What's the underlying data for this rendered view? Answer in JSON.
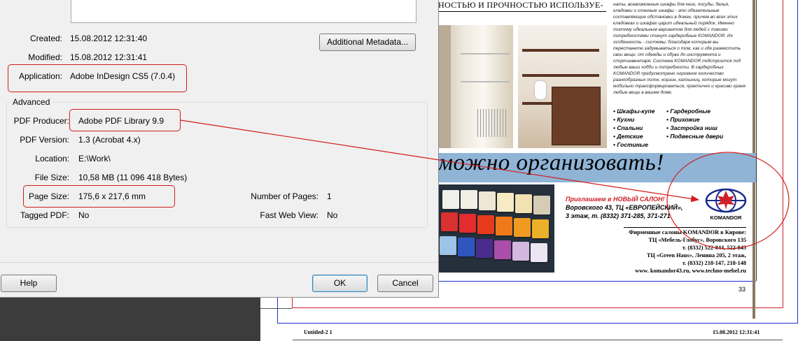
{
  "dialog": {
    "rows": {
      "created": {
        "label": "Created:",
        "value": "15.08.2012 12:31:40"
      },
      "modified": {
        "label": "Modified:",
        "value": "15.08.2012 12:31:41"
      },
      "application": {
        "label": "Application:",
        "value": "Adobe InDesign CS5 (7.0.4)"
      }
    },
    "additional_metadata_label": "Additional Metadata...",
    "advanced": {
      "title": "Advanced",
      "pdf_producer": {
        "label": "PDF Producer:",
        "value": "Adobe PDF Library 9.9"
      },
      "pdf_version": {
        "label": "PDF Version:",
        "value": "1.3 (Acrobat 4.x)"
      },
      "location": {
        "label": "Location:",
        "value": "E:\\Work\\"
      },
      "file_size": {
        "label": "File Size:",
        "value": "10,58 MB (11 096 418 Bytes)"
      },
      "page_size": {
        "label": "Page Size:",
        "value": "175,6 x 217,6 mm"
      },
      "number_of_pages": {
        "label": "Number of Pages:",
        "value": "1"
      },
      "tagged_pdf": {
        "label": "Tagged PDF:",
        "value": "No"
      },
      "fast_web_view": {
        "label": "Fast Web View:",
        "value": "No"
      }
    },
    "buttons": {
      "help": "Help",
      "ok": "OK",
      "cancel": "Cancel"
    }
  },
  "document": {
    "headline": "НОСТЬЮ И ПРОЧНОСТЬЮ ИСПОЛЬЗУЕ-",
    "blurb": "наты, всевозможные шкафы для книг, посуды, белья, кладовки и стенные шкафы - это обязательные составляющие обстановки в домах, причем во всех этих кладовках и шкафах царит идеальный порядок. Именно поэтому идеальным вариантом для людей с такими потребностями станут гардеробные KOMANDOR. Их особенность - системы, благодаря которым вы перестанете задумываться о том, как и где разместить свои вещи: от одежды и обуви до инструмента и спортинвентаря. Система KOMANDOR подстроится под любые ваши хобби и потребности. В гардеробных KOMANDOR предусмотрено огромное количество разнообразных полок, корзин, калошниц, которые могут мобильно трансформироваться, практично и красиво храня любые вещи в вашем доме.",
    "bullets_left": [
      "• Шкафы-купе",
      "• Кухни",
      "• Спальни",
      "• Детские",
      "• Гостиные"
    ],
    "bullets_right": [
      "• Гардеробные",
      "• Прихожие",
      "• Застройка ниш",
      "• Подвесные двери"
    ],
    "slogan": "можно организовать!",
    "invite_red": "Приглашаем в НОВЫЙ САЛОН!",
    "invite_lines": [
      "Воровского 43, ТЦ «ЕВРОПЕЙСКИЙ»,",
      "3 этаж, т. (8332) 371-285, 371-271"
    ],
    "logo_text": "KOMANDOR",
    "salons": [
      "Фирменные салоны KOMANDOR в Кирове:",
      "ТЦ «Мебель-Глобус», Воровского 135",
      "т. (8332) 522-844, 522-843",
      "ТЦ «Green Haus», Ленина 205, 2 этаж,",
      "т. (8332) 218-147, 218-148",
      "www. komandor43.ru, www.techno-mebel.ru"
    ],
    "page_number": "33",
    "footer_left": "Untitled-2   1",
    "footer_right": "15.08.2012   12:31:41"
  },
  "colors": {
    "highlight_red": "#d21d1d",
    "trim_blue": "#1f2fd0",
    "slogan_band": "#8fb4d6"
  }
}
